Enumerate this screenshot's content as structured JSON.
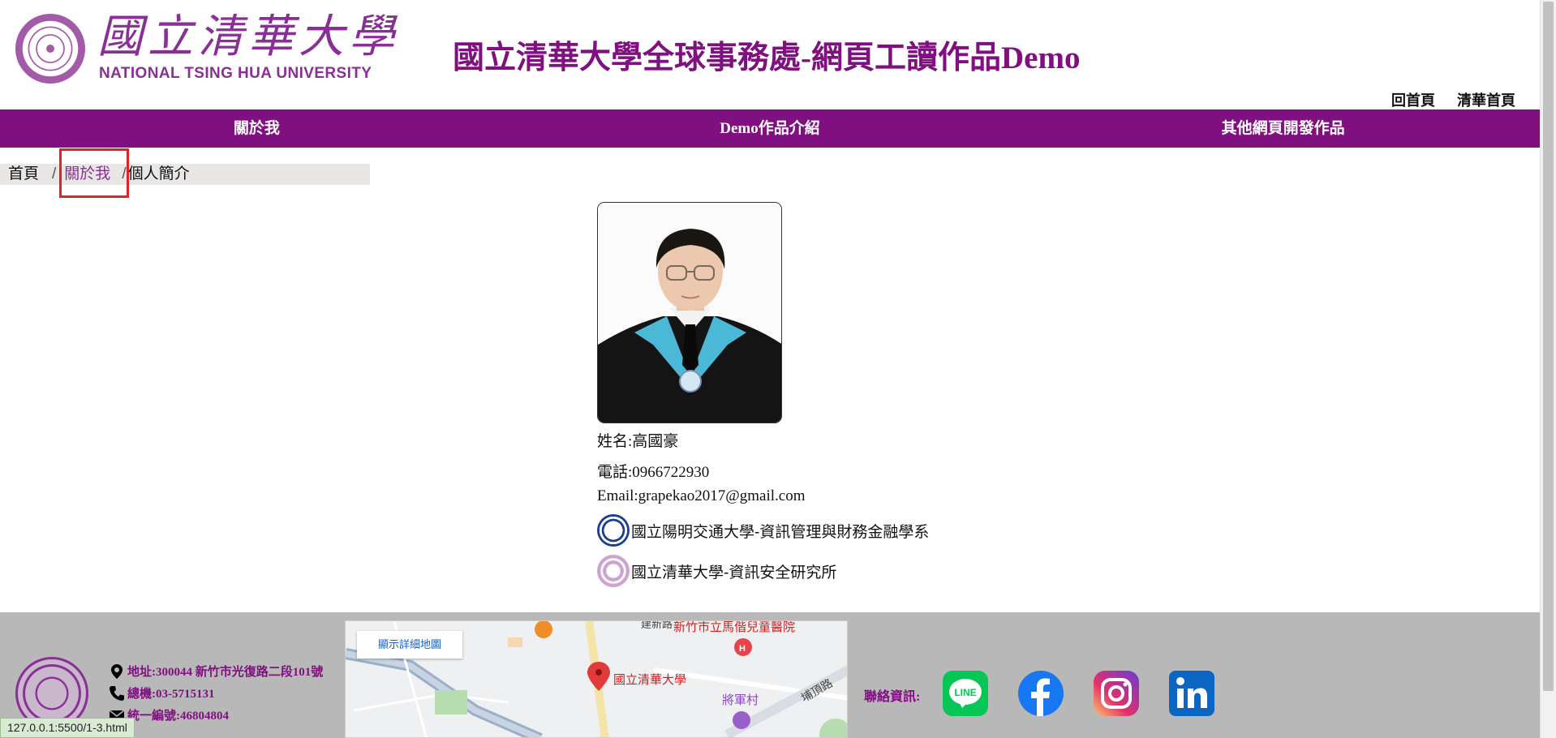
{
  "header": {
    "logo_cn": "國立清華大學",
    "logo_en": "NATIONAL TSING HUA UNIVERSITY",
    "site_title": "國立清華大學全球事務處-網頁工讀作品Demo",
    "top_links": [
      "回首頁",
      "清華首頁"
    ]
  },
  "nav": {
    "items": [
      "關於我",
      "Demo作品介紹",
      "其他網頁開發作品"
    ]
  },
  "breadcrumb": {
    "home": "首頁",
    "separator": "/",
    "section": "關於我",
    "current": "個人簡介"
  },
  "profile": {
    "name": "姓名:高國豪",
    "phone": "電話:0966722930",
    "email": "Email:grapekao2017@gmail.com",
    "schools": [
      {
        "name": "國立陽明交通大學-資訊管理與財務金融學系",
        "logo": "nycu-logo"
      },
      {
        "name": "國立清華大學-資訊安全研究所",
        "logo": "nthu-logo"
      }
    ]
  },
  "footer": {
    "address": "地址:300044 新竹市光復路二段101號",
    "phone": "總機:03-5715131",
    "tax_id": "統一編號:46804804",
    "map": {
      "button": "顯示詳細地圖",
      "marker_label": "國立清華大學",
      "hospital_label": "新竹市立馬偕兒童醫院",
      "village_label": "將軍村",
      "road_label": "埔頂路",
      "road_label_2": "建新路"
    },
    "contact_label": "聯絡資訊:",
    "social": [
      "LINE",
      "facebook",
      "instagram",
      "linkedin"
    ]
  },
  "status_bar": "127.0.0.1:5500/1-3.html",
  "colors": {
    "brand_purple": "#801080",
    "footer_bg": "#b9b8b8",
    "breadcrumb_bg": "#e9e7e5",
    "highlight_red": "#e02424"
  }
}
